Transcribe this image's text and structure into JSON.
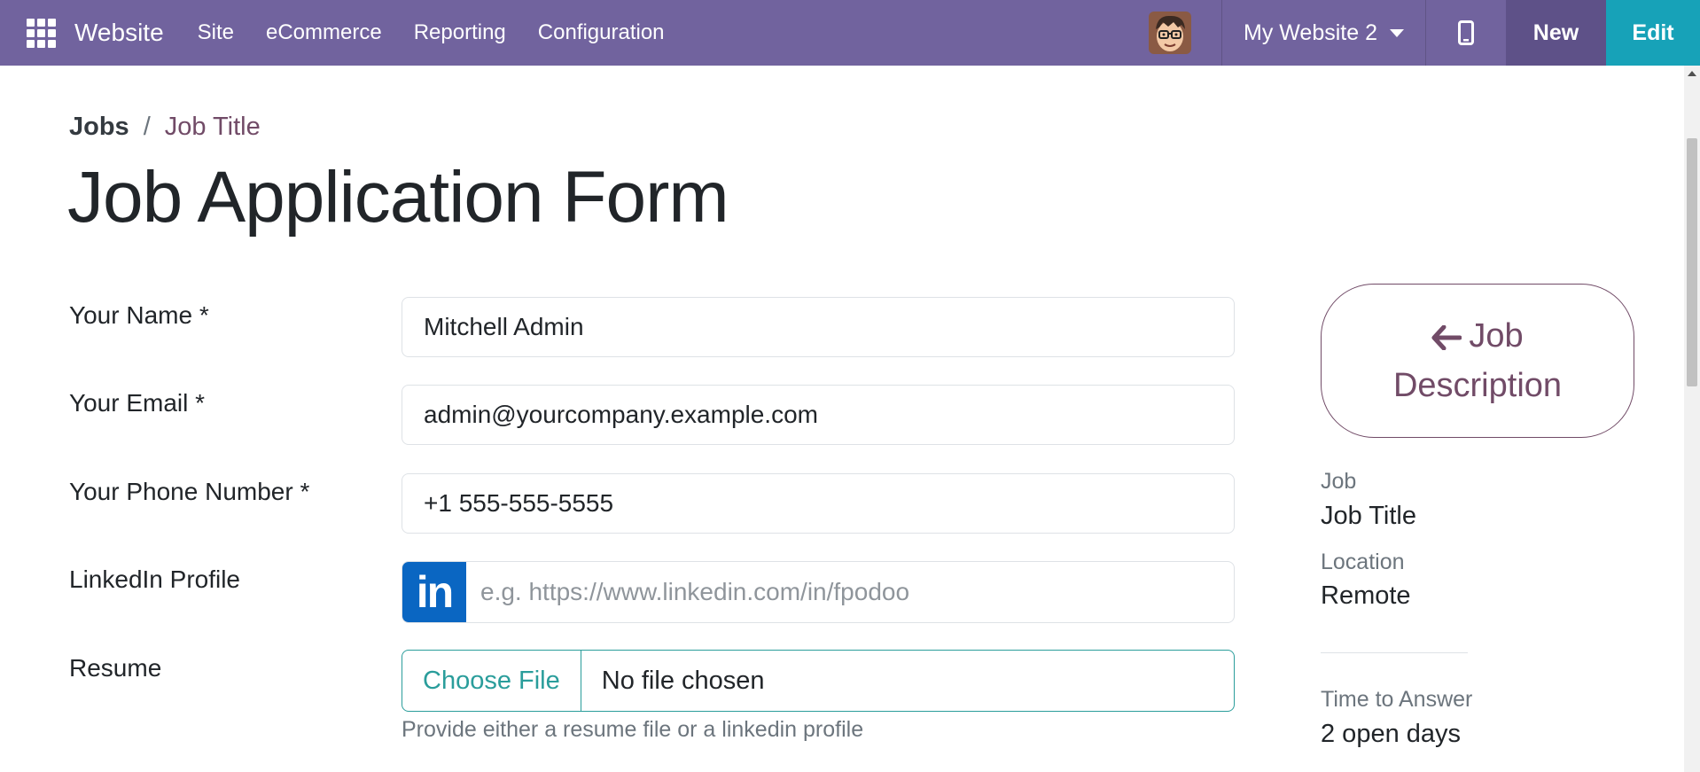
{
  "navbar": {
    "brand": "Website",
    "menu": [
      "Site",
      "eCommerce",
      "Reporting",
      "Configuration"
    ],
    "website_switch": "My Website 2",
    "new_label": "New",
    "edit_label": "Edit",
    "background_color": "#71639e",
    "edit_color": "#17a2b8"
  },
  "breadcrumb": {
    "parent": "Jobs",
    "separator": "/",
    "current": "Job Title"
  },
  "page_title": "Job Application Form",
  "form": {
    "name": {
      "label": "Your Name *",
      "value": "Mitchell Admin"
    },
    "email": {
      "label": "Your Email *",
      "value": "admin@yourcompany.example.com"
    },
    "phone": {
      "label": "Your Phone Number *",
      "value": "+1 555-555-5555"
    },
    "linkedin": {
      "label": "LinkedIn Profile",
      "logo_text": "in",
      "placeholder": "e.g. https://www.linkedin.com/in/fpodoo"
    },
    "resume": {
      "label": "Resume",
      "button": "Choose File",
      "status": "No file chosen",
      "help": "Provide either a resume file or a linkedin profile"
    }
  },
  "sidebar": {
    "job_description_line1": "Job",
    "job_description_line2": "Description",
    "job_label": "Job",
    "job_value": "Job Title",
    "location_label": "Location",
    "location_value": "Remote",
    "time_label": "Time to Answer",
    "time_value": "2 open days"
  },
  "icons": {
    "apps": "grid-icon",
    "avatar": "user-avatar",
    "mobile": "mobile-phone-icon",
    "back": "arrow-left-icon",
    "linkedin": "linkedin-icon"
  }
}
